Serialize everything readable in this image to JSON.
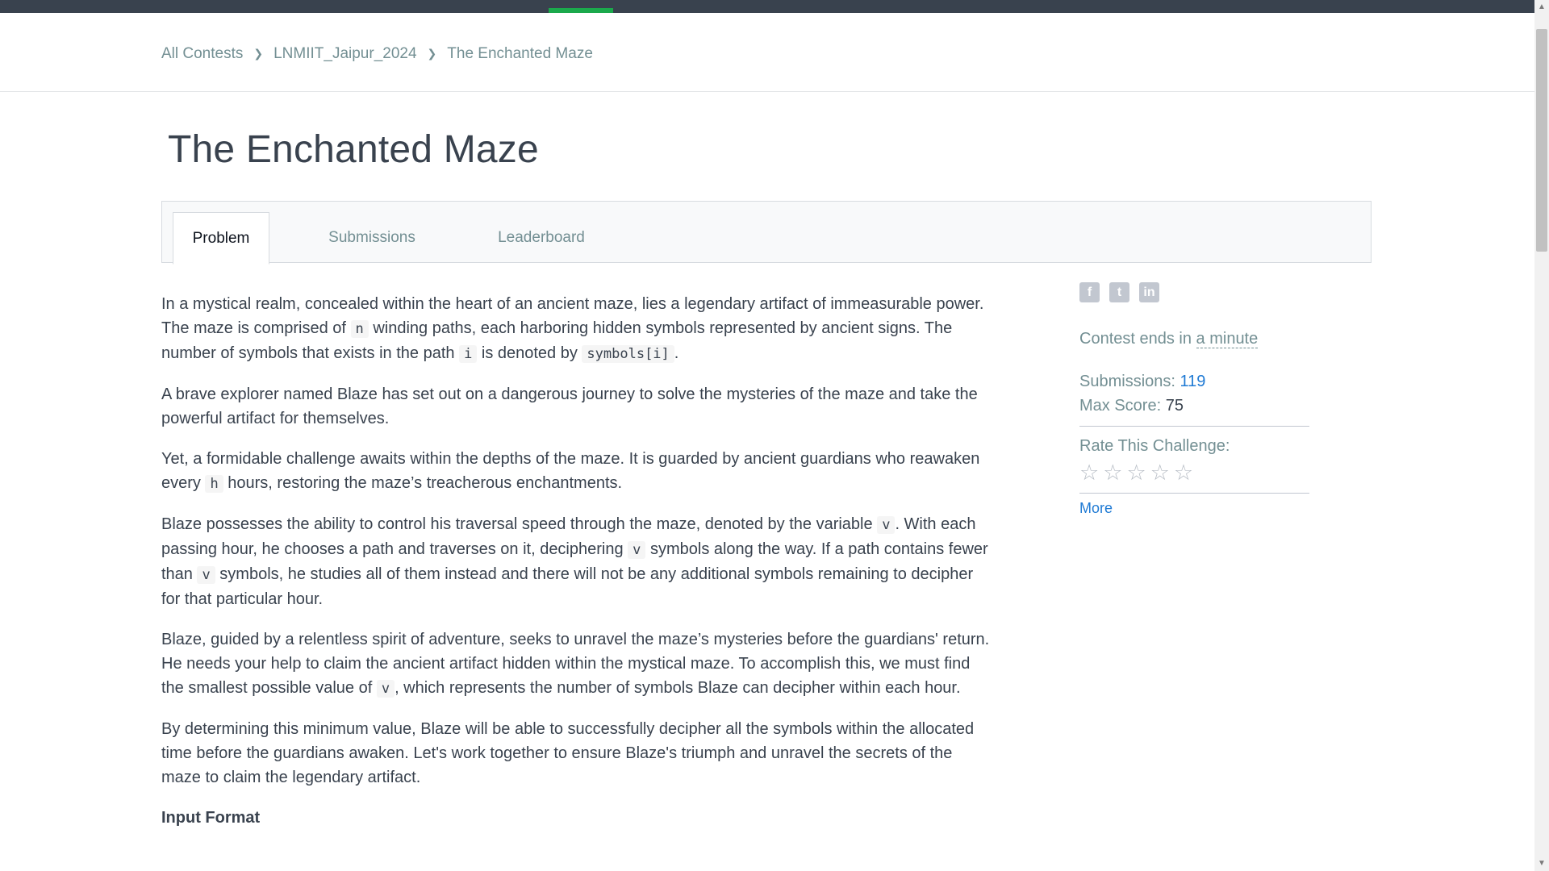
{
  "breadcrumb": {
    "items": [
      "All Contests",
      "LNMIIT_Jaipur_2024",
      "The Enchanted Maze"
    ]
  },
  "title": "The Enchanted Maze",
  "tabs": [
    {
      "label": "Problem",
      "active": true
    },
    {
      "label": "Submissions"
    },
    {
      "label": "Leaderboard"
    }
  ],
  "problem": {
    "p1": {
      "t1": "In a mystical realm, concealed within the heart of an ancient maze, lies a legendary artifact of immeasurable power. The maze is comprised of ",
      "c1": "n",
      "t2": " winding paths, each harboring hidden symbols represented by ancient signs. The number of symbols that exists in the path ",
      "c2": "i",
      "t3": " is denoted by ",
      "c3": "symbols[i]",
      "t4": "."
    },
    "p2": "A brave explorer named Blaze has set out on a dangerous journey to solve the mysteries of the maze and take the powerful artifact for themselves.",
    "p3": {
      "t1": "Yet, a formidable challenge awaits within the depths of the maze. It is guarded by ancient guardians who reawaken every ",
      "c1": "h",
      "t2": " hours, restoring the maze’s treacherous enchantments."
    },
    "p4": {
      "t1": "Blaze possesses the ability to control his traversal speed through the maze, denoted by the variable ",
      "c1": "v",
      "t2": ". With each passing hour, he chooses a path and traverses on it, deciphering ",
      "c2": "v",
      "t3": " symbols along the way. If a path contains fewer than ",
      "c3": "v",
      "t4": " symbols, he studies all of them instead and there will not be any additional symbols remaining to decipher for that particular hour."
    },
    "p5": {
      "t1": "Blaze, guided by a relentless spirit of adventure, seeks to unravel the maze’s mysteries before the guardians' return. He needs your help to claim the ancient artifact hidden within the mystical maze. To accomplish this, we must find the smallest possible value of ",
      "c1": "v",
      "t2": ", which represents the number of symbols Blaze can decipher within each hour."
    },
    "p6": "By determining this minimum value, Blaze will be able to successfully decipher all the symbols within the allocated time before the guardians awaken. Let's work together to ensure Blaze's triumph and unravel the secrets of the maze to claim the legendary artifact.",
    "input_format_heading": "Input Format"
  },
  "sidebar": {
    "share_icons": [
      {
        "icon": "facebook-icon",
        "glyph": "f"
      },
      {
        "icon": "twitter-icon",
        "glyph": "t"
      },
      {
        "icon": "linkedin-icon",
        "glyph": "in"
      }
    ],
    "contest_ends_prefix": "Contest ends in ",
    "contest_ends_value": "a minute",
    "submissions_label": "Submissions:",
    "submissions_value": "119",
    "max_score_label": "Max Score:",
    "max_score_value": "75",
    "rate_label": "Rate This Challenge:",
    "stars": [
      "☆",
      "☆",
      "☆",
      "☆",
      "☆"
    ],
    "more_label": "More"
  },
  "colors": {
    "nav_bg": "#39424e",
    "nav_indicator": "#1ba94c",
    "link_blue": "#1f7ad4",
    "muted_text": "#738f93"
  }
}
